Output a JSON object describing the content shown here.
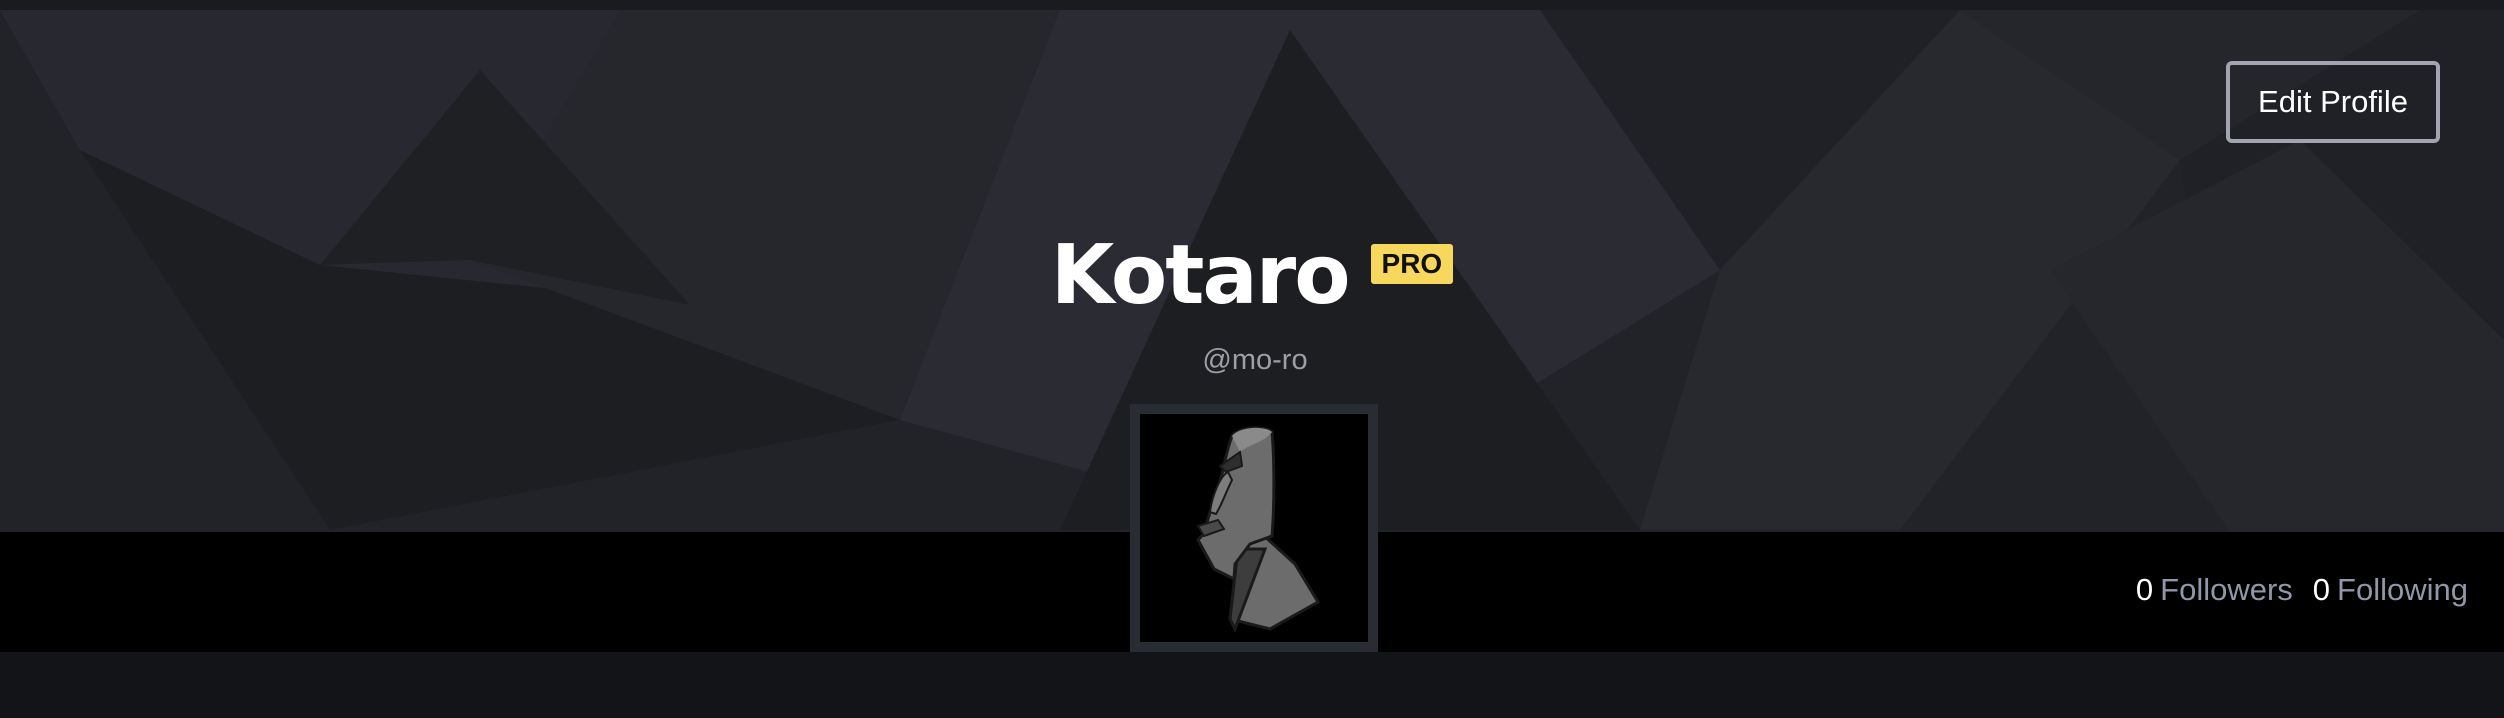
{
  "profile": {
    "display_name": "Kotaro",
    "badge": "PRO",
    "handle": "@mo-ro",
    "avatar_icon": "moai-icon"
  },
  "header": {
    "edit_label": "Edit Profile"
  },
  "stats": {
    "followers_count": "0",
    "followers_label": "Followers",
    "following_count": "0",
    "following_label": "Following"
  },
  "colors": {
    "badge_bg": "#f7d85c",
    "hero_bg": "#222328",
    "strip_bg": "#000000",
    "button_border": "#a3a4b2"
  }
}
